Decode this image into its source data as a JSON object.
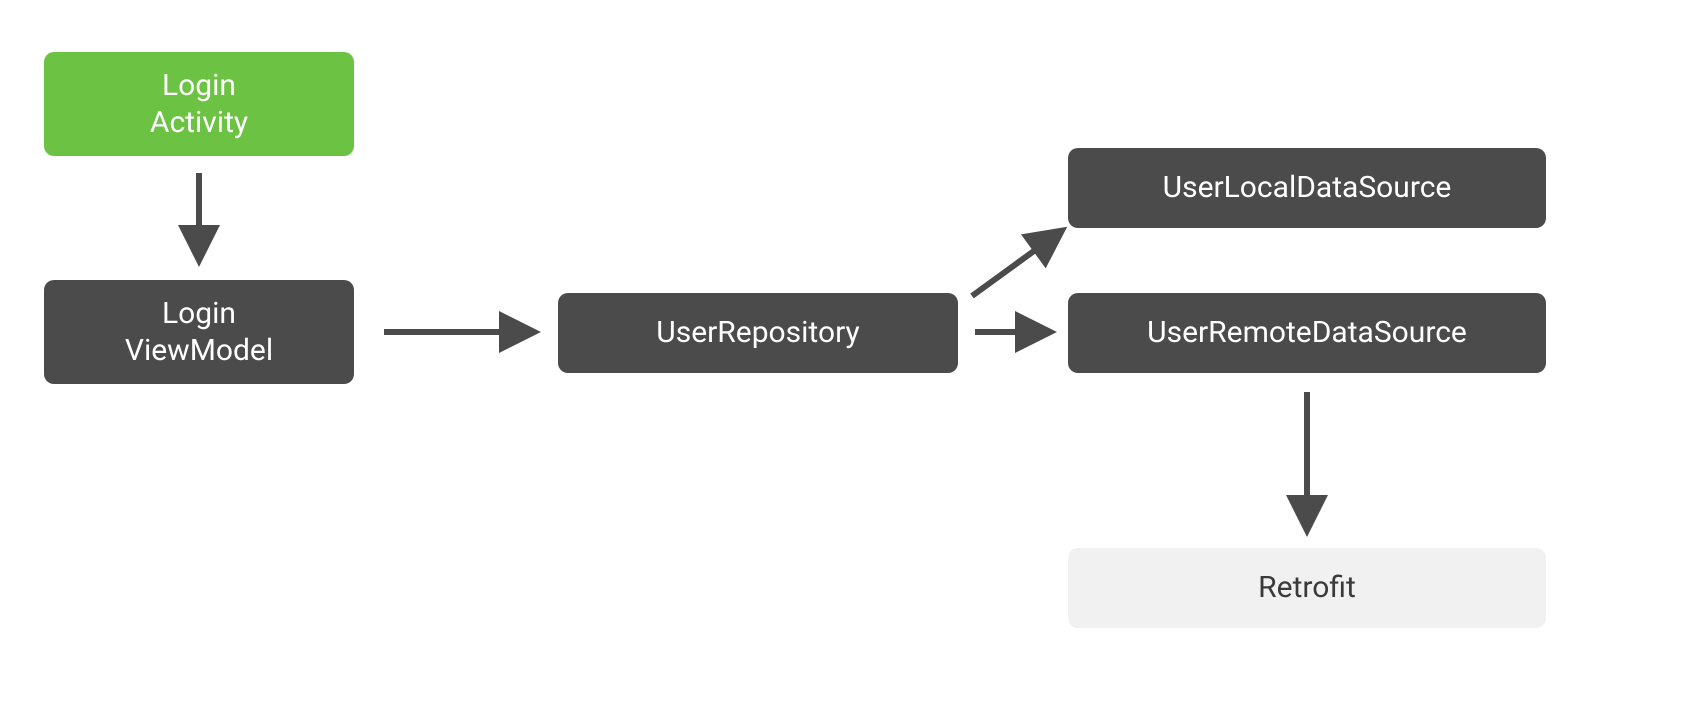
{
  "diagram": {
    "nodes": {
      "loginActivity": "Login\nActivity",
      "loginViewModel": "Login\nViewModel",
      "userRepository": "UserRepository",
      "userLocalDataSource": "UserLocalDataSource",
      "userRemoteDataSource": "UserRemoteDataSource",
      "retrofit": "Retrofit"
    },
    "colors": {
      "green": "#6bc243",
      "dark": "#4b4b4b",
      "light": "#f1f1f1",
      "arrow": "#4b4b4b"
    },
    "edges": [
      {
        "from": "loginActivity",
        "to": "loginViewModel"
      },
      {
        "from": "loginViewModel",
        "to": "userRepository"
      },
      {
        "from": "userRepository",
        "to": "userLocalDataSource"
      },
      {
        "from": "userRepository",
        "to": "userRemoteDataSource"
      },
      {
        "from": "userRemoteDataSource",
        "to": "retrofit"
      }
    ]
  }
}
